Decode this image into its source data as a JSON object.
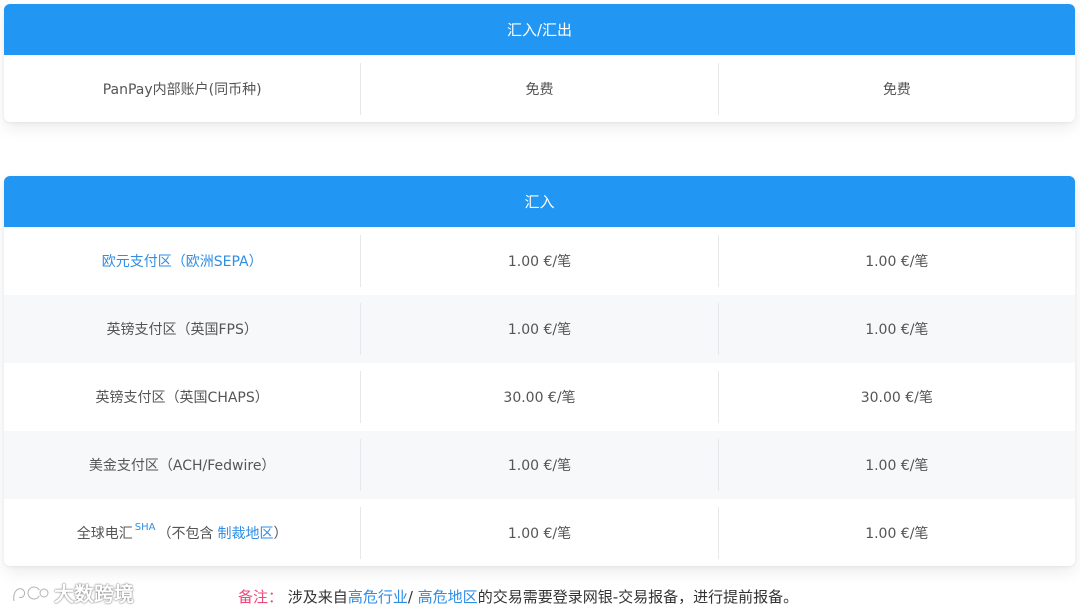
{
  "section1": {
    "title": "汇入/汇出",
    "rows": [
      {
        "label": "PanPay内部账户(同币种)",
        "col2": "免费",
        "col3": "免费"
      }
    ]
  },
  "section2": {
    "title": "汇入",
    "rows": [
      {
        "label": "欧元支付区（欧洲SEPA）",
        "col2": "1.00 €/笔",
        "col3": "1.00 €/笔"
      },
      {
        "label": "英镑支付区（英国FPS）",
        "col2": "1.00 €/笔",
        "col3": "1.00 €/笔"
      },
      {
        "label": "英镑支付区（英国CHAPS）",
        "col2": "30.00 €/笔",
        "col3": "30.00 €/笔"
      },
      {
        "label": "美金支付区（ACH/Fedwire）",
        "col2": "1.00 €/笔",
        "col3": "1.00 €/笔"
      },
      {
        "label_prefix": "全球电汇",
        "label_sup": "SHA",
        "label_mid": "（不包含",
        "label_link": "制裁地区",
        "label_suffix": "）",
        "col2": "1.00 €/笔",
        "col3": "1.00 €/笔"
      }
    ]
  },
  "note": {
    "label": "备注：",
    "text_before": "涉及来自",
    "link1": "高危行业",
    "sep": "/",
    "link2": "高危地区",
    "text_after": "的交易需要登录网银-交易报备，进行提前报备。"
  },
  "watermark": {
    "text": "大数跨境"
  },
  "colors": {
    "header": "#2196f3",
    "link": "#2f8de4",
    "note_label": "#f0477c"
  }
}
